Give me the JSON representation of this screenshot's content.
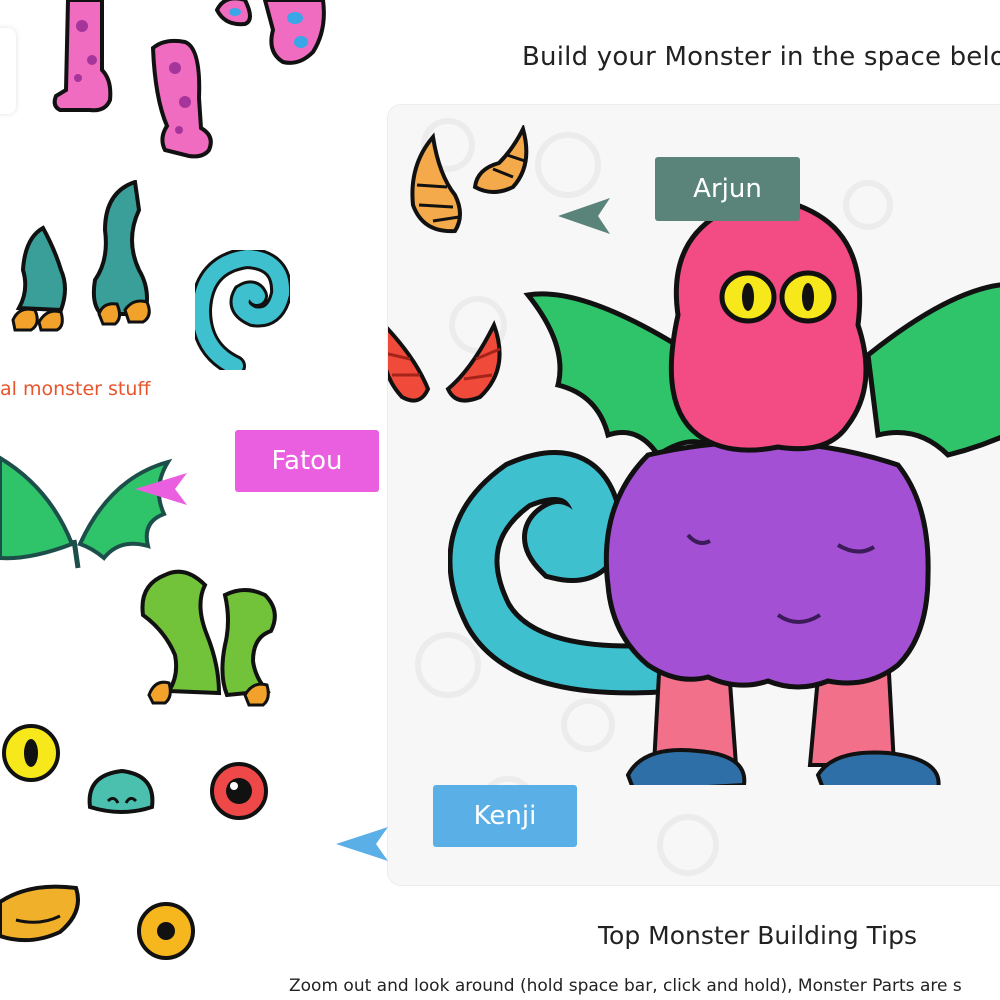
{
  "heading": "Build your Monster in the space belo",
  "section_label": "al monster stuff",
  "tags": {
    "arjun": "Arjun",
    "fatou": "Fatou",
    "kenji": "Kenji"
  },
  "tips": {
    "title": "Top Monster Building Tips",
    "text": "Zoom out and look around (hold space bar, click and hold), Monster Parts are s"
  },
  "colors": {
    "arjun_tag": "#5a8479",
    "fatou_tag": "#ea5fe0",
    "kenji_tag": "#5aafe7",
    "section_label": "#e8542c"
  }
}
